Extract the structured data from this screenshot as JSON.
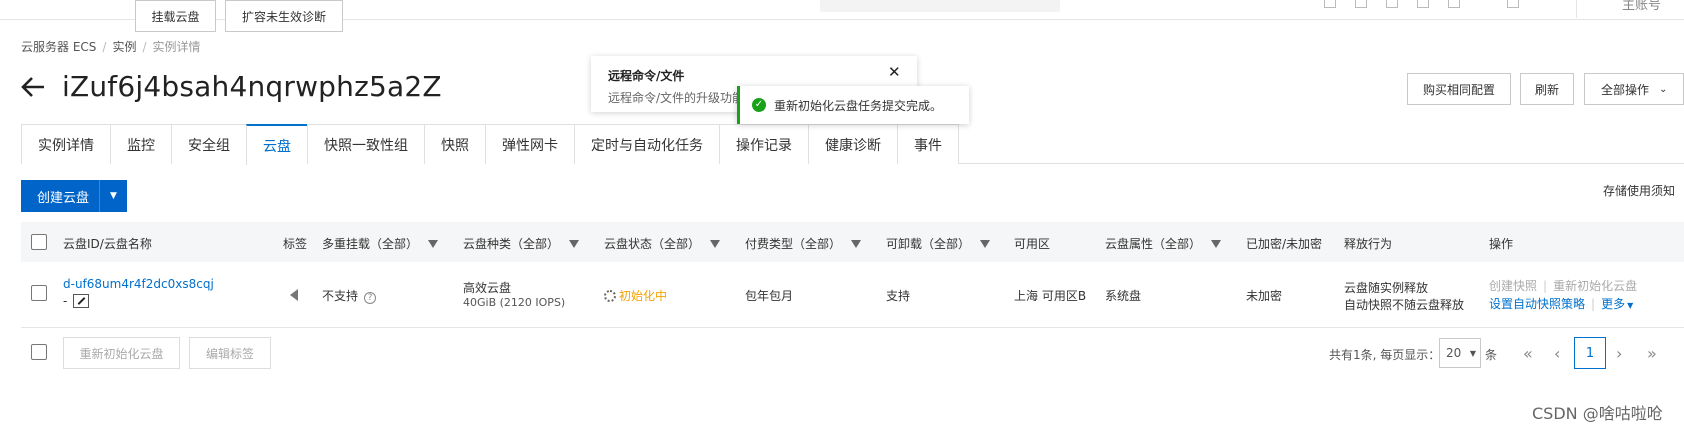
{
  "topbar": {
    "account_label": "主账号"
  },
  "breadcrumb": {
    "items": [
      "云服务器 ECS",
      "实例",
      "实例详情"
    ]
  },
  "header": {
    "instance_id": "iZuf6j4bsah4nqrwphz5a2Z",
    "buttons": {
      "buy_same": "购买相同配置",
      "refresh": "刷新",
      "all_actions": "全部操作"
    }
  },
  "tabs": [
    {
      "label": "实例详情"
    },
    {
      "label": "监控"
    },
    {
      "label": "安全组"
    },
    {
      "label": "云盘",
      "active": true
    },
    {
      "label": "快照一致性组"
    },
    {
      "label": "快照"
    },
    {
      "label": "弹性网卡"
    },
    {
      "label": "定时与自动化任务"
    },
    {
      "label": "操作记录"
    },
    {
      "label": "健康诊断"
    },
    {
      "label": "事件"
    }
  ],
  "actions": {
    "create_disk": "创建云盘",
    "attach_disk": "挂载云盘",
    "expand_diagnose": "扩容未生效诊断",
    "storage_notice": "存储使用须知"
  },
  "table": {
    "headers": {
      "disk_id": "云盘ID/云盘名称",
      "tag": "标签",
      "multi_attach": "多重挂载（全部）",
      "disk_type": "云盘种类（全部）",
      "status": "云盘状态（全部）",
      "billing": "付费类型（全部）",
      "detachable": "可卸载（全部）",
      "zone": "可用区",
      "attribute": "云盘属性（全部）",
      "encryption": "已加密/未加密",
      "release": "释放行为",
      "ops": "操作"
    },
    "rows": [
      {
        "disk_id": "d-uf68um4r4f2dc0xs8cqj",
        "disk_name": "-",
        "multi_attach": "不支持",
        "disk_type": "高效云盘",
        "disk_size": "40GiB (2120 IOPS)",
        "status": "初始化中",
        "billing": "包年包月",
        "detachable": "支持",
        "zone": "上海 可用区B",
        "attribute": "系统盘",
        "encryption": "未加密",
        "release_1": "云盘随实例释放",
        "release_2": "自动快照不随云盘释放",
        "op_create_snapshot": "创建快照",
        "op_reinit": "重新初始化云盘",
        "op_auto_snapshot": "设置自动快照策略",
        "op_more": "更多"
      }
    ]
  },
  "footer": {
    "reinit_disk": "重新初始化云盘",
    "edit_tags": "编辑标签",
    "total_text": "共有1条, 每页显示：",
    "page_size": "20",
    "page_size_suffix": "条",
    "current_page": "1"
  },
  "popover": {
    "title": "远程命令/文件",
    "body": "远程命令/文件的升级功能"
  },
  "toast": {
    "message": "重新初始化云盘任务提交完成。"
  },
  "watermark": "CSDN @啥咕啦呛",
  "colors": {
    "primary": "#0064c8",
    "link": "#0070cc",
    "success": "#1aa11a",
    "warning": "#f5a200"
  }
}
